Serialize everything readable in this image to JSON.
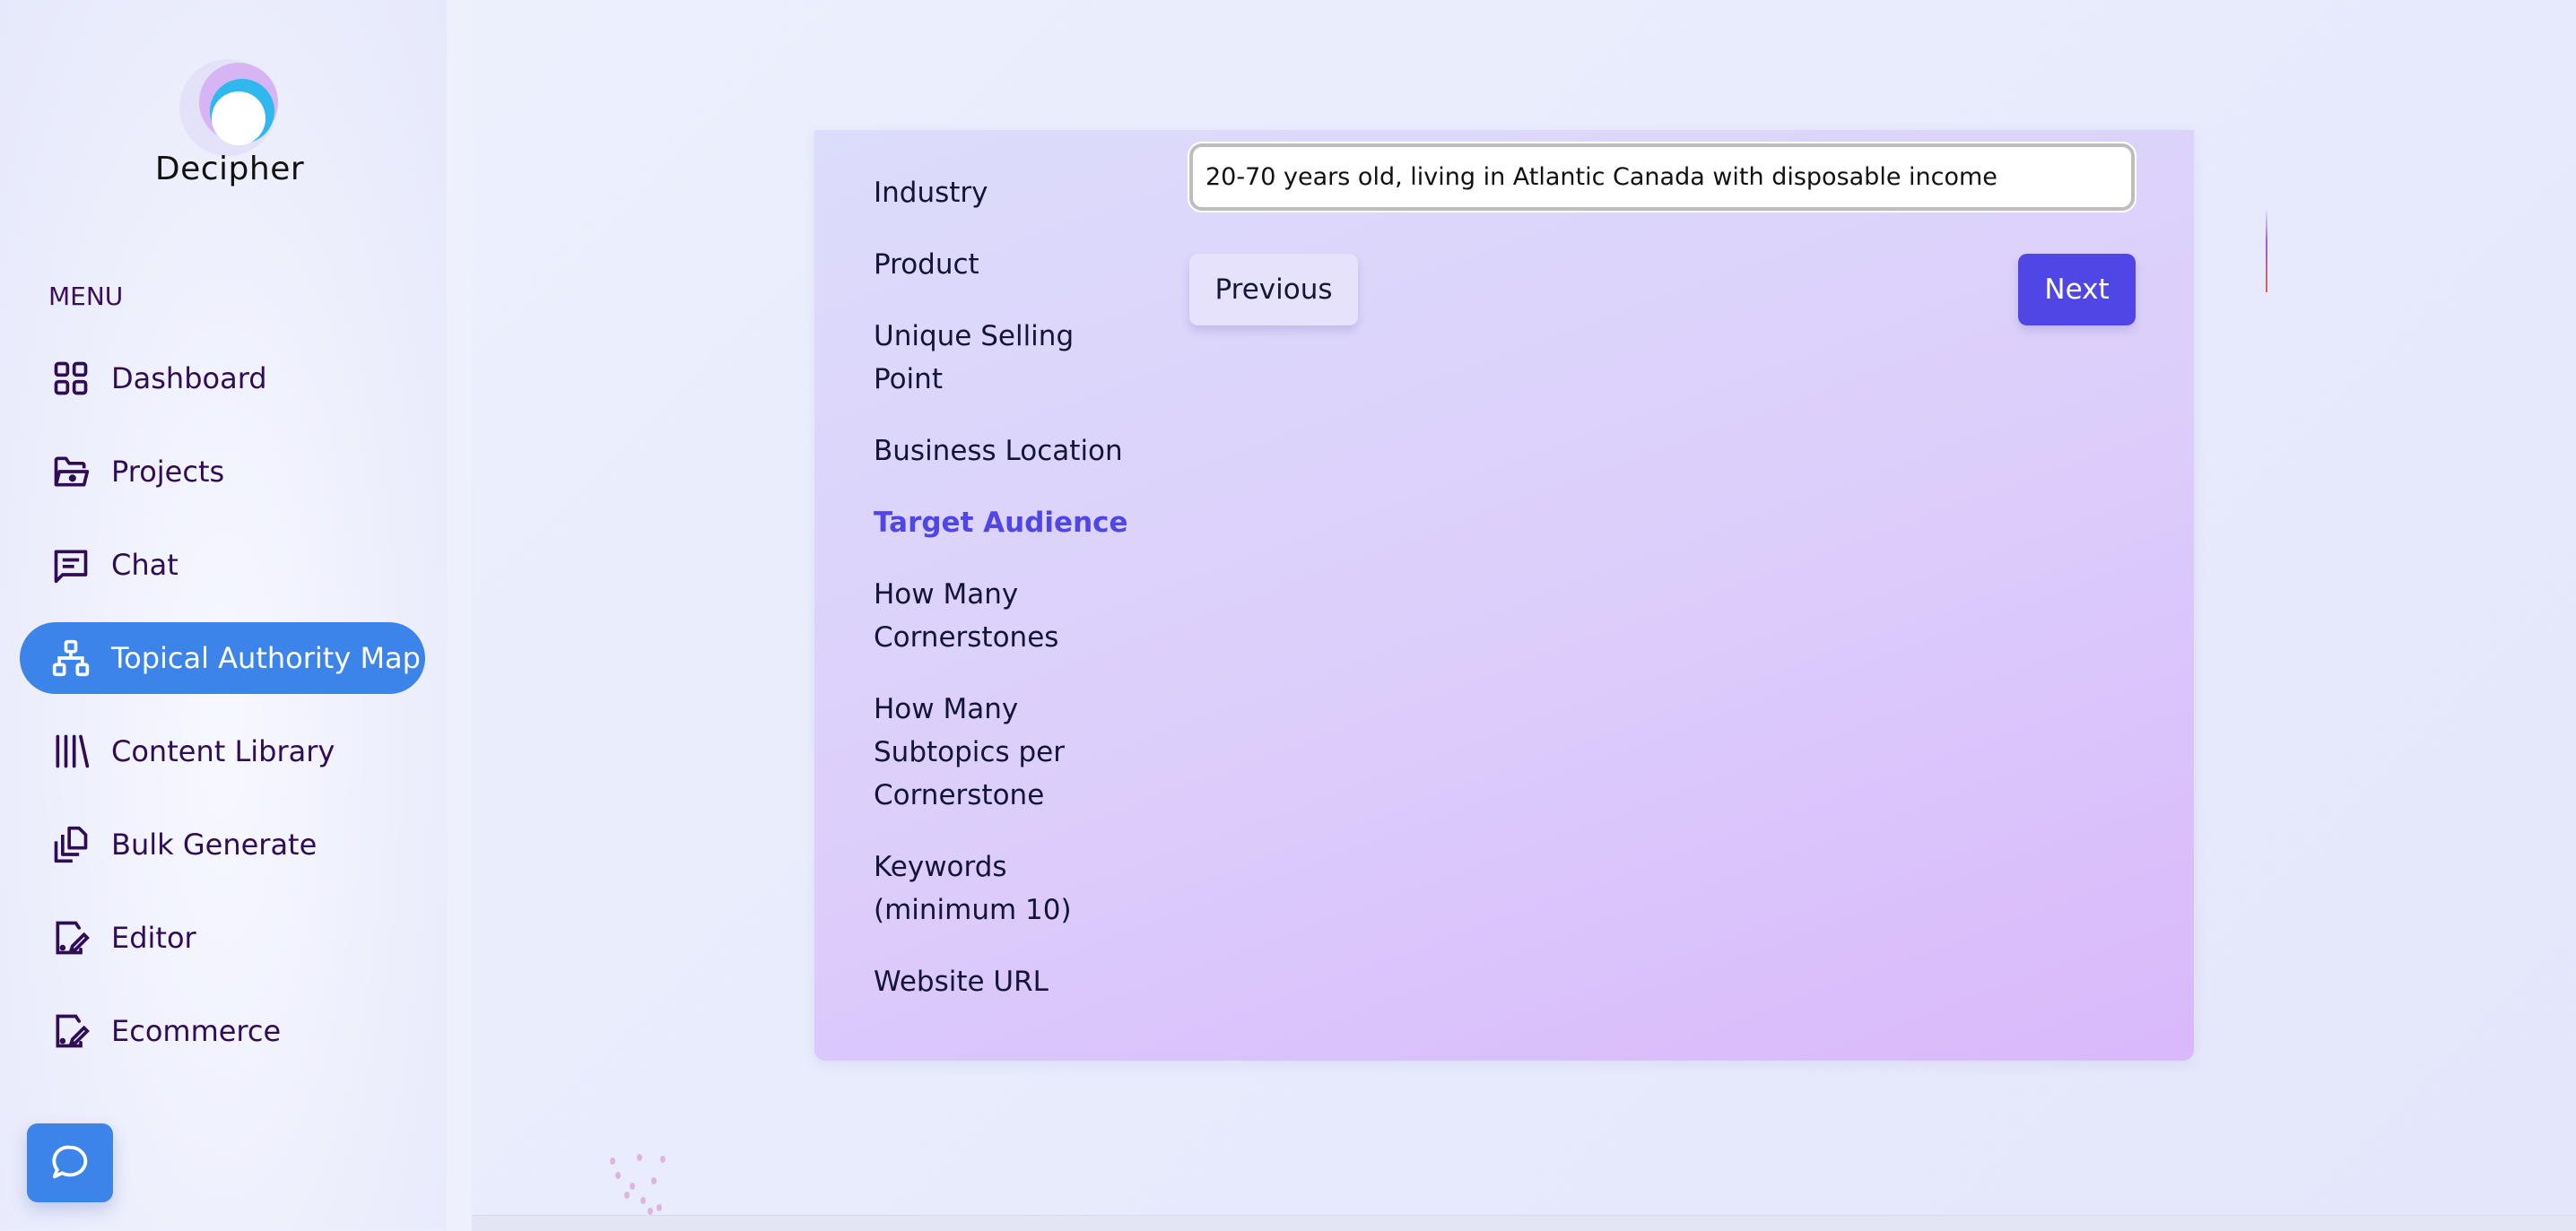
{
  "brand": {
    "name": "Decipher",
    "icon": "decipher-logo"
  },
  "sidebar": {
    "menu_label": "MENU",
    "items": [
      {
        "label": "Dashboard",
        "icon": "grid-icon",
        "active": false
      },
      {
        "label": "Projects",
        "icon": "folder-icon",
        "active": false
      },
      {
        "label": "Chat",
        "icon": "message-square-icon",
        "active": false
      },
      {
        "label": "Topical Authority Map",
        "icon": "sitemap-icon",
        "active": true
      },
      {
        "label": "Content Library",
        "icon": "library-icon",
        "active": false
      },
      {
        "label": "Bulk Generate",
        "icon": "copy-files-icon",
        "active": false
      },
      {
        "label": "Editor",
        "icon": "edit-document-icon",
        "active": false
      },
      {
        "label": "Ecommerce",
        "icon": "edit-document-icon",
        "active": false
      }
    ],
    "chat_button_icon": "chat-bubble-icon"
  },
  "wizard": {
    "steps": [
      {
        "label": "Industry",
        "active": false
      },
      {
        "label": "Product",
        "active": false
      },
      {
        "label": "Unique Selling Point",
        "active": false
      },
      {
        "label": "Business Location",
        "active": false
      },
      {
        "label": "Target Audience",
        "active": true
      },
      {
        "label": "How Many Cornerstones",
        "active": false
      },
      {
        "label": "How Many Subtopics per Cornerstone",
        "active": false
      },
      {
        "label": "Keywords (minimum 10)",
        "active": false
      },
      {
        "label": "Website URL",
        "active": false
      }
    ],
    "answer_value": "20-70 years old, living in Atlantic Canada with disposable income",
    "previous_label": "Previous",
    "next_label": "Next"
  },
  "colors": {
    "accent_blue": "#3c84ea",
    "primary_indigo": "#4f46e5",
    "nav_text": "#2f0c55"
  }
}
